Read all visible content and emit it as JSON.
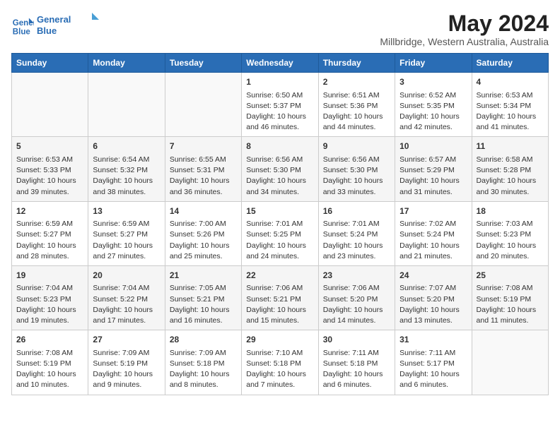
{
  "logo": {
    "line1": "General",
    "line2": "Blue"
  },
  "title": "May 2024",
  "subtitle": "Millbridge, Western Australia, Australia",
  "weekdays": [
    "Sunday",
    "Monday",
    "Tuesday",
    "Wednesday",
    "Thursday",
    "Friday",
    "Saturday"
  ],
  "weeks": [
    [
      {
        "day": "",
        "sunrise": "",
        "sunset": "",
        "daylight": ""
      },
      {
        "day": "",
        "sunrise": "",
        "sunset": "",
        "daylight": ""
      },
      {
        "day": "",
        "sunrise": "",
        "sunset": "",
        "daylight": ""
      },
      {
        "day": "1",
        "sunrise": "Sunrise: 6:50 AM",
        "sunset": "Sunset: 5:37 PM",
        "daylight": "Daylight: 10 hours and 46 minutes."
      },
      {
        "day": "2",
        "sunrise": "Sunrise: 6:51 AM",
        "sunset": "Sunset: 5:36 PM",
        "daylight": "Daylight: 10 hours and 44 minutes."
      },
      {
        "day": "3",
        "sunrise": "Sunrise: 6:52 AM",
        "sunset": "Sunset: 5:35 PM",
        "daylight": "Daylight: 10 hours and 42 minutes."
      },
      {
        "day": "4",
        "sunrise": "Sunrise: 6:53 AM",
        "sunset": "Sunset: 5:34 PM",
        "daylight": "Daylight: 10 hours and 41 minutes."
      }
    ],
    [
      {
        "day": "5",
        "sunrise": "Sunrise: 6:53 AM",
        "sunset": "Sunset: 5:33 PM",
        "daylight": "Daylight: 10 hours and 39 minutes."
      },
      {
        "day": "6",
        "sunrise": "Sunrise: 6:54 AM",
        "sunset": "Sunset: 5:32 PM",
        "daylight": "Daylight: 10 hours and 38 minutes."
      },
      {
        "day": "7",
        "sunrise": "Sunrise: 6:55 AM",
        "sunset": "Sunset: 5:31 PM",
        "daylight": "Daylight: 10 hours and 36 minutes."
      },
      {
        "day": "8",
        "sunrise": "Sunrise: 6:56 AM",
        "sunset": "Sunset: 5:30 PM",
        "daylight": "Daylight: 10 hours and 34 minutes."
      },
      {
        "day": "9",
        "sunrise": "Sunrise: 6:56 AM",
        "sunset": "Sunset: 5:30 PM",
        "daylight": "Daylight: 10 hours and 33 minutes."
      },
      {
        "day": "10",
        "sunrise": "Sunrise: 6:57 AM",
        "sunset": "Sunset: 5:29 PM",
        "daylight": "Daylight: 10 hours and 31 minutes."
      },
      {
        "day": "11",
        "sunrise": "Sunrise: 6:58 AM",
        "sunset": "Sunset: 5:28 PM",
        "daylight": "Daylight: 10 hours and 30 minutes."
      }
    ],
    [
      {
        "day": "12",
        "sunrise": "Sunrise: 6:59 AM",
        "sunset": "Sunset: 5:27 PM",
        "daylight": "Daylight: 10 hours and 28 minutes."
      },
      {
        "day": "13",
        "sunrise": "Sunrise: 6:59 AM",
        "sunset": "Sunset: 5:27 PM",
        "daylight": "Daylight: 10 hours and 27 minutes."
      },
      {
        "day": "14",
        "sunrise": "Sunrise: 7:00 AM",
        "sunset": "Sunset: 5:26 PM",
        "daylight": "Daylight: 10 hours and 25 minutes."
      },
      {
        "day": "15",
        "sunrise": "Sunrise: 7:01 AM",
        "sunset": "Sunset: 5:25 PM",
        "daylight": "Daylight: 10 hours and 24 minutes."
      },
      {
        "day": "16",
        "sunrise": "Sunrise: 7:01 AM",
        "sunset": "Sunset: 5:24 PM",
        "daylight": "Daylight: 10 hours and 23 minutes."
      },
      {
        "day": "17",
        "sunrise": "Sunrise: 7:02 AM",
        "sunset": "Sunset: 5:24 PM",
        "daylight": "Daylight: 10 hours and 21 minutes."
      },
      {
        "day": "18",
        "sunrise": "Sunrise: 7:03 AM",
        "sunset": "Sunset: 5:23 PM",
        "daylight": "Daylight: 10 hours and 20 minutes."
      }
    ],
    [
      {
        "day": "19",
        "sunrise": "Sunrise: 7:04 AM",
        "sunset": "Sunset: 5:23 PM",
        "daylight": "Daylight: 10 hours and 19 minutes."
      },
      {
        "day": "20",
        "sunrise": "Sunrise: 7:04 AM",
        "sunset": "Sunset: 5:22 PM",
        "daylight": "Daylight: 10 hours and 17 minutes."
      },
      {
        "day": "21",
        "sunrise": "Sunrise: 7:05 AM",
        "sunset": "Sunset: 5:21 PM",
        "daylight": "Daylight: 10 hours and 16 minutes."
      },
      {
        "day": "22",
        "sunrise": "Sunrise: 7:06 AM",
        "sunset": "Sunset: 5:21 PM",
        "daylight": "Daylight: 10 hours and 15 minutes."
      },
      {
        "day": "23",
        "sunrise": "Sunrise: 7:06 AM",
        "sunset": "Sunset: 5:20 PM",
        "daylight": "Daylight: 10 hours and 14 minutes."
      },
      {
        "day": "24",
        "sunrise": "Sunrise: 7:07 AM",
        "sunset": "Sunset: 5:20 PM",
        "daylight": "Daylight: 10 hours and 13 minutes."
      },
      {
        "day": "25",
        "sunrise": "Sunrise: 7:08 AM",
        "sunset": "Sunset: 5:19 PM",
        "daylight": "Daylight: 10 hours and 11 minutes."
      }
    ],
    [
      {
        "day": "26",
        "sunrise": "Sunrise: 7:08 AM",
        "sunset": "Sunset: 5:19 PM",
        "daylight": "Daylight: 10 hours and 10 minutes."
      },
      {
        "day": "27",
        "sunrise": "Sunrise: 7:09 AM",
        "sunset": "Sunset: 5:19 PM",
        "daylight": "Daylight: 10 hours and 9 minutes."
      },
      {
        "day": "28",
        "sunrise": "Sunrise: 7:09 AM",
        "sunset": "Sunset: 5:18 PM",
        "daylight": "Daylight: 10 hours and 8 minutes."
      },
      {
        "day": "29",
        "sunrise": "Sunrise: 7:10 AM",
        "sunset": "Sunset: 5:18 PM",
        "daylight": "Daylight: 10 hours and 7 minutes."
      },
      {
        "day": "30",
        "sunrise": "Sunrise: 7:11 AM",
        "sunset": "Sunset: 5:18 PM",
        "daylight": "Daylight: 10 hours and 6 minutes."
      },
      {
        "day": "31",
        "sunrise": "Sunrise: 7:11 AM",
        "sunset": "Sunset: 5:17 PM",
        "daylight": "Daylight: 10 hours and 6 minutes."
      },
      {
        "day": "",
        "sunrise": "",
        "sunset": "",
        "daylight": ""
      }
    ]
  ]
}
